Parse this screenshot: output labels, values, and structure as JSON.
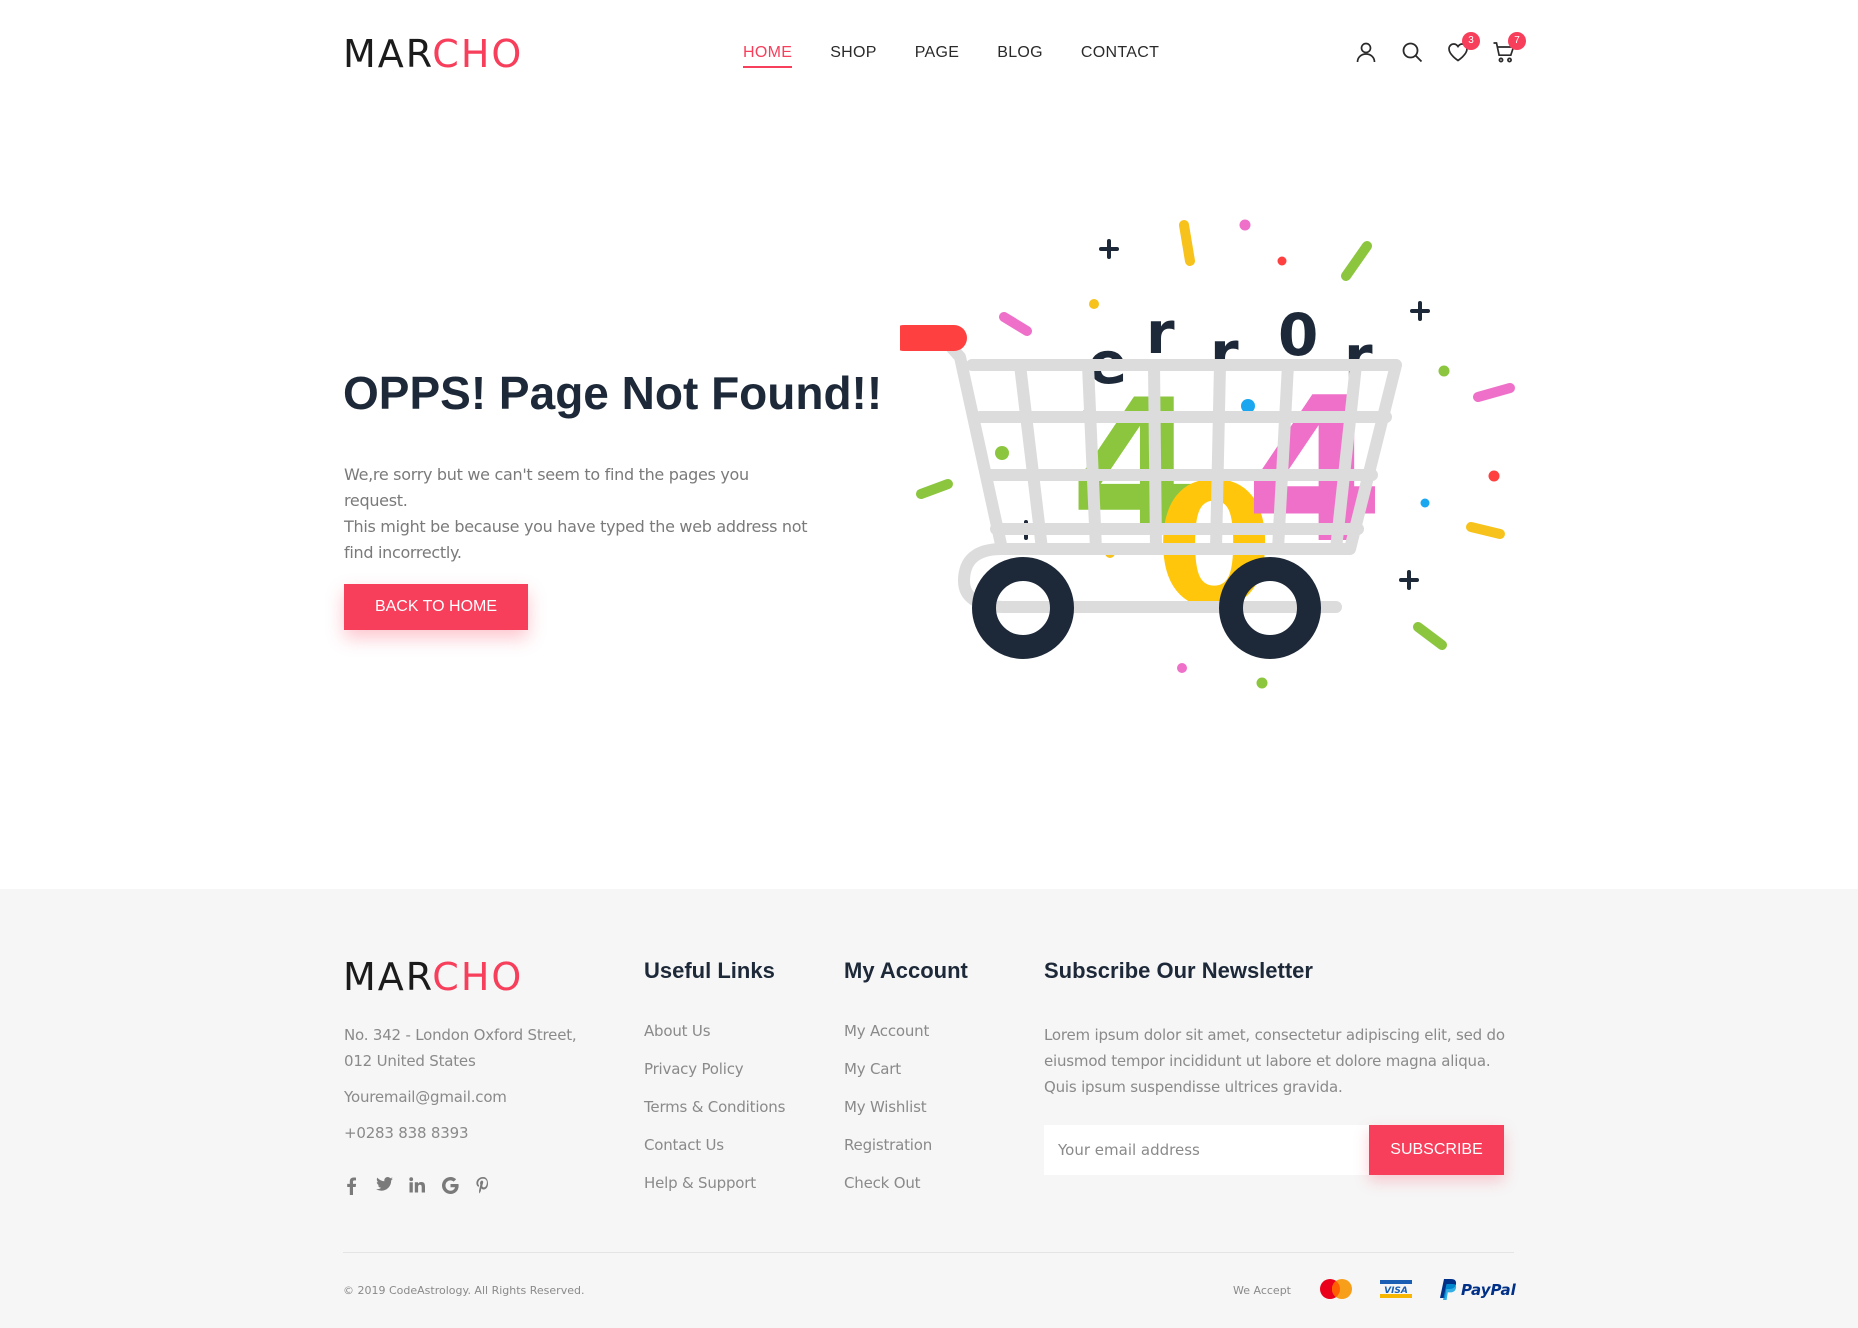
{
  "brand": {
    "part1": "MAR",
    "part2": "CHO",
    "accent": "#f73e5b",
    "dark": "#1d2939"
  },
  "nav": {
    "items": [
      {
        "label": "HOME",
        "active": true
      },
      {
        "label": "SHOP"
      },
      {
        "label": "PAGE"
      },
      {
        "label": "BLOG"
      },
      {
        "label": "CONTACT"
      }
    ]
  },
  "header_icons": {
    "user": "user-icon",
    "search": "search-icon",
    "wishlist": {
      "icon": "heart-icon",
      "count": "3"
    },
    "cart": {
      "icon": "cart-icon",
      "count": "7"
    }
  },
  "hero": {
    "title": "OPPS! Page Not Found!!",
    "desc_lines": [
      "We,re sorry but we can't seem to find the pages you request.",
      "This might be because you have typed the web address not",
      "find incorrectly."
    ],
    "button": "BACK TO HOME"
  },
  "illustration": {
    "letters": [
      "e",
      "r",
      "r",
      "0",
      "r"
    ],
    "digits": [
      "4",
      "0",
      "4"
    ]
  },
  "footer": {
    "address_lines": [
      "No. 342 - London Oxford Street,",
      "012 United States"
    ],
    "email": "Youremail@gmail.com",
    "phone": "+0283 838 8393",
    "socials": [
      "facebook-icon",
      "twitter-icon",
      "linkedin-icon",
      "google-icon",
      "pinterest-icon"
    ],
    "useful_links": {
      "heading": "Useful Links",
      "items": [
        "About Us",
        "Privacy Policy",
        "Terms & Conditions",
        "Contact Us",
        "Help & Support"
      ]
    },
    "my_account": {
      "heading": "My Account",
      "items": [
        "My Account",
        "My Cart",
        "My Wishlist",
        "Registration",
        "Check Out"
      ]
    },
    "newsletter": {
      "heading": "Subscribe Our Newsletter",
      "desc_lines": [
        "Lorem ipsum dolor sit amet, consectetur adipiscing elit, sed do",
        "eiusmod tempor incididunt ut labore et dolore magna aliqua.",
        "Quis ipsum suspendisse ultrices gravida."
      ],
      "placeholder": "Your email address",
      "button": "SUBSCRIBE"
    },
    "copyright": "© 2019 CodeAstrology. All Rights Reserved.",
    "we_accept": "We Accept",
    "payments": {
      "mastercard": "mastercard-icon",
      "visa": "VISA",
      "paypal": "PayPal"
    }
  }
}
